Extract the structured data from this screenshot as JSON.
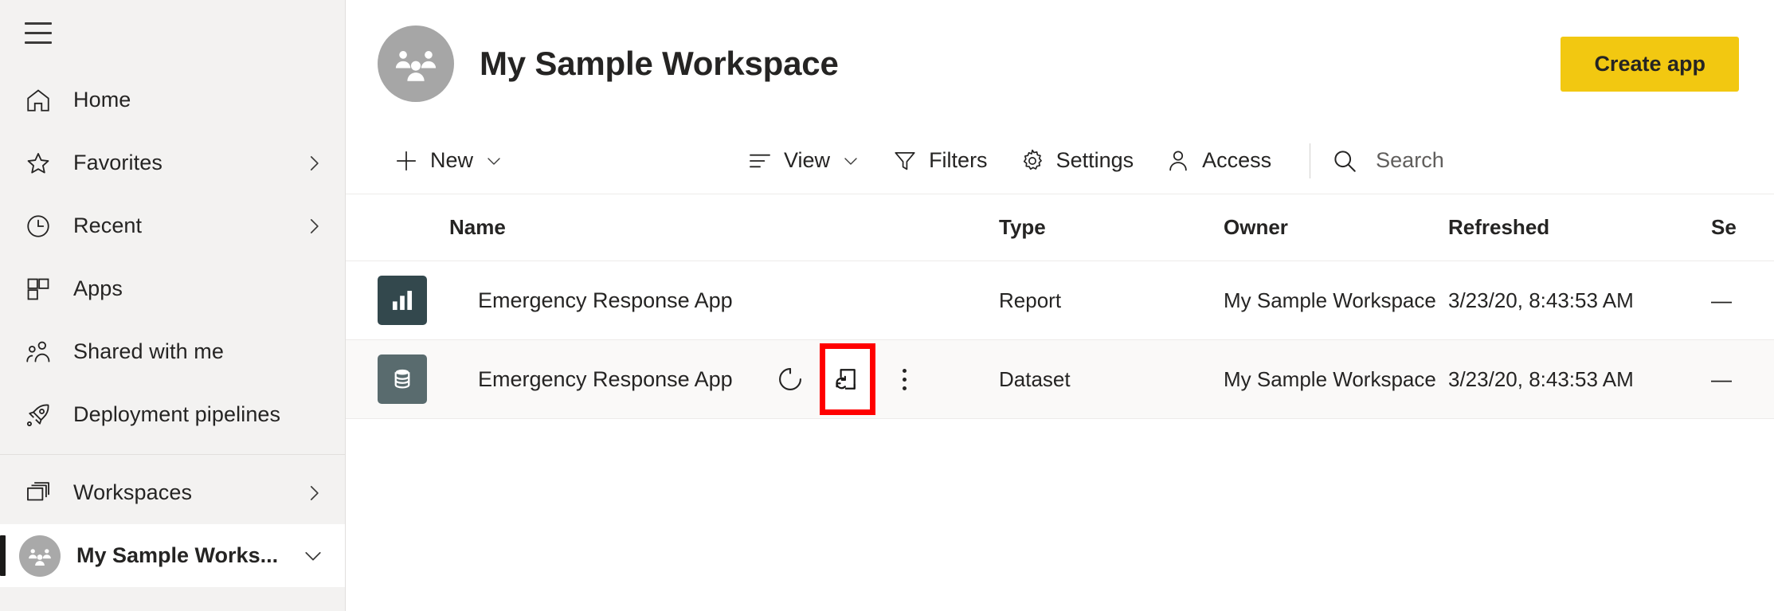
{
  "sidebar": {
    "menu_button": "menu-icon",
    "items": [
      {
        "label": "Home",
        "icon": "home-icon",
        "chevron": false
      },
      {
        "label": "Favorites",
        "icon": "star-icon",
        "chevron": true
      },
      {
        "label": "Recent",
        "icon": "clock-icon",
        "chevron": true
      },
      {
        "label": "Apps",
        "icon": "apps-grid-icon",
        "chevron": false
      },
      {
        "label": "Shared with me",
        "icon": "people-icon",
        "chevron": false
      },
      {
        "label": "Deployment pipelines",
        "icon": "rocket-icon",
        "chevron": false
      },
      {
        "label": "Workspaces",
        "icon": "workspaces-stack-icon",
        "chevron": true
      }
    ],
    "selected_workspace": {
      "label": "My Sample Works...",
      "avatar_icon": "group-avatar-icon",
      "chevron": true
    }
  },
  "header": {
    "avatar_icon": "group-avatar-icon",
    "title": "My Sample Workspace",
    "create_app_label": "Create app",
    "accent_color": "#F2C811"
  },
  "toolbar": {
    "new_label": "New",
    "new_icon": "plus-icon",
    "view_label": "View",
    "view_icon": "view-list-icon",
    "filters_label": "Filters",
    "filters_icon": "funnel-icon",
    "settings_label": "Settings",
    "settings_icon": "gear-icon",
    "access_label": "Access",
    "access_icon": "person-icon",
    "search_icon": "search-icon",
    "search_placeholder": "Search",
    "search_value": ""
  },
  "table": {
    "columns": [
      "Name",
      "Type",
      "Owner",
      "Refreshed",
      "Se"
    ],
    "rows": [
      {
        "icon": "report-bar-chart-icon",
        "name": "Emergency Response App",
        "type": "Report",
        "owner": "My Sample Workspace",
        "refreshed": "3/23/20, 8:43:53 AM",
        "sensitivity": "—",
        "has_actions": false,
        "hovered": false
      },
      {
        "icon": "dataset-database-icon",
        "name": "Emergency Response App",
        "type": "Dataset",
        "owner": "My Sample Workspace",
        "refreshed": "3/23/20, 8:43:53 AM",
        "sensitivity": "—",
        "has_actions": true,
        "hovered": true,
        "actions": [
          {
            "name": "refresh-now-icon",
            "label": "Refresh now",
            "highlighted": false
          },
          {
            "name": "schedule-refresh-icon",
            "label": "Schedule refresh",
            "highlighted": true
          },
          {
            "name": "more-options-icon",
            "label": "More options",
            "highlighted": false
          }
        ]
      }
    ]
  },
  "highlight": {
    "color": "#FF0000",
    "target": "schedule-refresh-icon"
  }
}
